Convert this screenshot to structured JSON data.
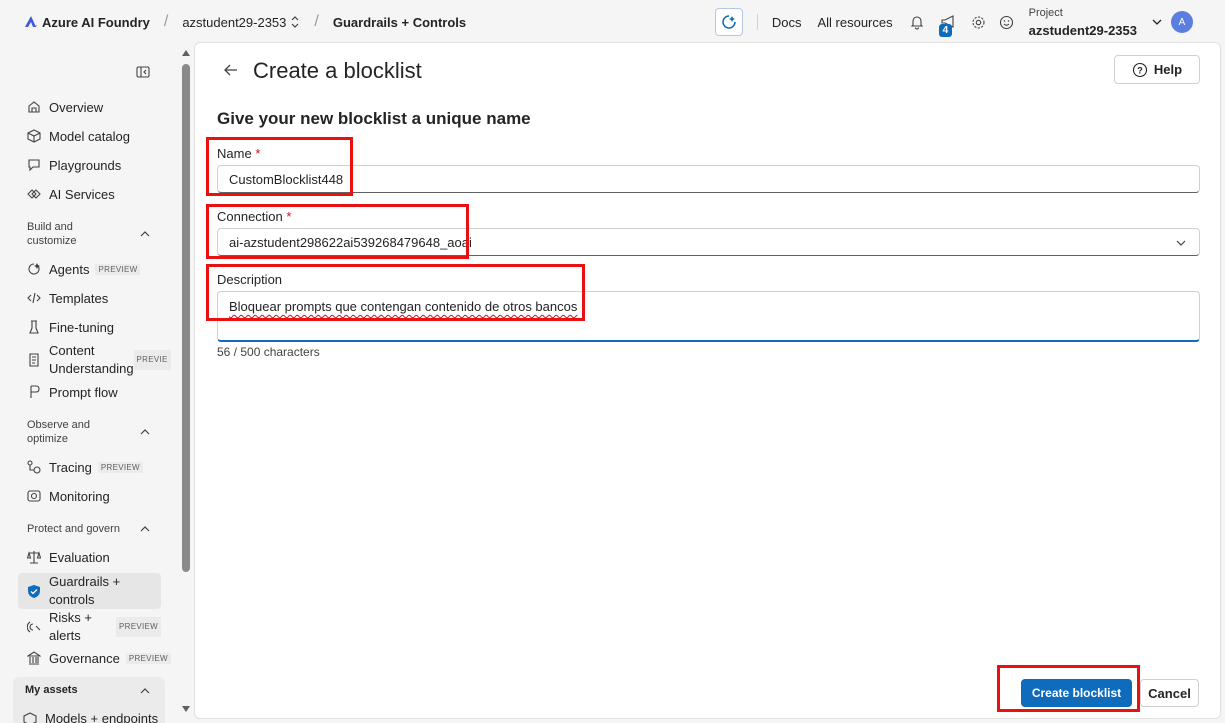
{
  "topbar": {
    "brand": "Azure AI Foundry",
    "project_crumb": "azstudent29-2353",
    "page_crumb": "Guardrails + Controls",
    "docs": "Docs",
    "all_resources": "All resources",
    "notification_count": "4",
    "project_label": "Project",
    "project_name": "azstudent29-2353",
    "avatar_initial": "A"
  },
  "sidebar": {
    "items": {
      "overview": "Overview",
      "model_catalog": "Model catalog",
      "playgrounds": "Playgrounds",
      "ai_services": "AI Services",
      "agents": "Agents",
      "templates": "Templates",
      "fine_tuning": "Fine-tuning",
      "content_understanding": "Content Understanding",
      "prompt_flow": "Prompt flow",
      "tracing": "Tracing",
      "monitoring": "Monitoring",
      "evaluation": "Evaluation",
      "guardrails": "Guardrails + controls",
      "risks": "Risks + alerts",
      "governance": "Governance",
      "models_endpoints": "Models + endpoints"
    },
    "sections": {
      "build": "Build and customize",
      "observe": "Observe and optimize",
      "protect": "Protect and govern",
      "assets": "My assets"
    },
    "preview_badge": "PREVIEW",
    "preview_badge_short": "PREVIE"
  },
  "main": {
    "title": "Create a blocklist",
    "help_label": "Help",
    "subheading": "Give your new blocklist a unique name",
    "name_label": "Name",
    "name_value": "CustomBlocklist448",
    "connection_label": "Connection",
    "connection_value": "ai-azstudent298622ai539268479648_aoai",
    "description_label": "Description",
    "description_value": "Bloquear prompts que contengan contenido de otros bancos",
    "char_counter": "56 / 500 characters",
    "required_marker": "*",
    "create_button": "Create blocklist",
    "cancel_button": "Cancel"
  },
  "colors": {
    "accent": "#0f6cbd",
    "highlight": "#e81010",
    "required": "#c50f1f"
  }
}
